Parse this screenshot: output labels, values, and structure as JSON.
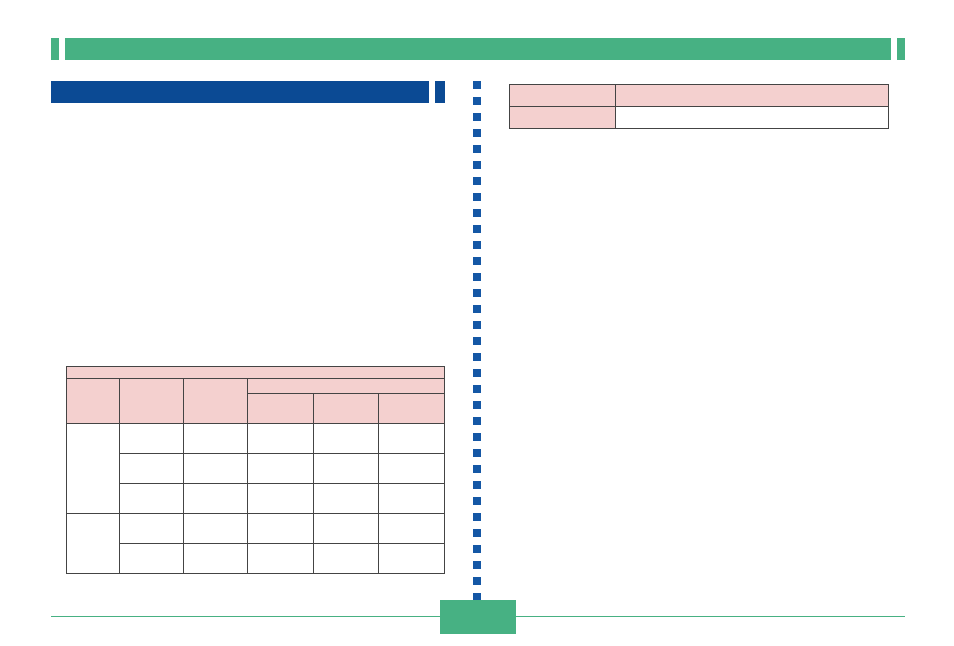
{
  "colors": {
    "green": "#47b183",
    "blue_header": "#0b4a94",
    "blue_dots": "#1457a5",
    "pink": "#f4d0cf"
  },
  "top_bar": {
    "title": ""
  },
  "blue_bar": {
    "title": ""
  },
  "left_table": {
    "header_row1": [
      "",
      "",
      "",
      "",
      "",
      ""
    ],
    "header_row2_group": "",
    "header_row2_sub": [
      "",
      "",
      ""
    ],
    "rows": [
      [
        "",
        "",
        "",
        "",
        "",
        ""
      ],
      [
        "",
        "",
        "",
        "",
        "",
        ""
      ],
      [
        "",
        "",
        "",
        "",
        "",
        ""
      ],
      [
        "",
        "",
        "",
        "",
        "",
        ""
      ],
      [
        "",
        "",
        "",
        "",
        "",
        ""
      ]
    ]
  },
  "right_table": {
    "header": [
      "",
      ""
    ],
    "row": [
      "",
      ""
    ]
  },
  "footer": {
    "page": ""
  }
}
